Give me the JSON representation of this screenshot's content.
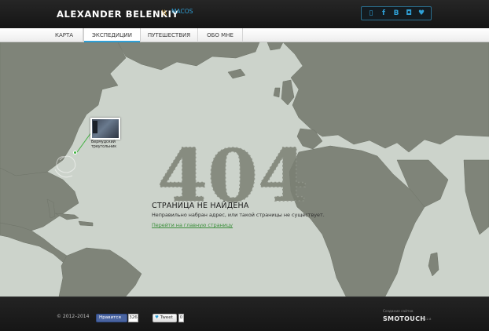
{
  "header": {
    "logo": "ALEXANDER BELENKIY",
    "separator": "\\\\",
    "os_label": "MACOS",
    "social_icons": [
      {
        "icon": "phone-icon",
        "glyph": "▯"
      },
      {
        "icon": "facebook-icon",
        "glyph": "f"
      },
      {
        "icon": "vk-icon",
        "glyph": "B"
      },
      {
        "icon": "instagram-icon",
        "glyph": "◘"
      },
      {
        "icon": "twitter-icon",
        "glyph": "♥"
      }
    ]
  },
  "nav": {
    "items": [
      {
        "label": "КАРТА"
      },
      {
        "label": "ЭКСПЕДИЦИИ"
      },
      {
        "label": "ПУТЕШЕСТВИЯ"
      },
      {
        "label": "ОБО МНЕ"
      }
    ],
    "active_index": 1
  },
  "main": {
    "error_code": "404",
    "title": "СТРАНИЦА НЕ НАЙДЕНА",
    "description": "Неправильно набран адрес, или такой страницы не существует.",
    "link": "Перейти на главную страницу",
    "marker": {
      "caption_line1": "Бермудский",
      "caption_line2": "треугольник"
    }
  },
  "footer": {
    "copyright": "© 2012–2014",
    "fb_like_label": "Нравится",
    "fb_like_count": "326",
    "tweet_label": "Tweet",
    "tweet_count": "0",
    "credit_small": "Создание сайтов",
    "credit_brand_a": "SMOTOUCH",
    "credit_brand_b": "",
    "credit_sub": "PC2.8"
  },
  "colors": {
    "map_background": "#ccd3cb",
    "land": "#7f8479",
    "accent_blue": "#2f9fd6",
    "link_green": "#3b8f3b"
  }
}
